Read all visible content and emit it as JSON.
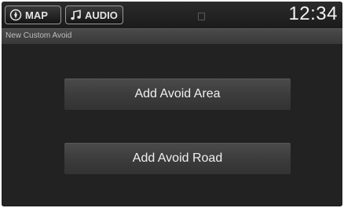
{
  "status_bar": {
    "map_label": "MAP",
    "audio_label": "AUDIO",
    "clock": "12:34",
    "icons": {
      "map": "compass-icon",
      "audio": "music-note-icon",
      "signal": "signal-indicator-icon"
    }
  },
  "screen": {
    "title": "New Custom Avoid"
  },
  "options": [
    {
      "label": "Add Avoid Area"
    },
    {
      "label": "Add Avoid Road"
    }
  ],
  "colors": {
    "background": "#222222",
    "title_bar": "#404040",
    "button": "#444444",
    "text": "#f0f0f0"
  }
}
